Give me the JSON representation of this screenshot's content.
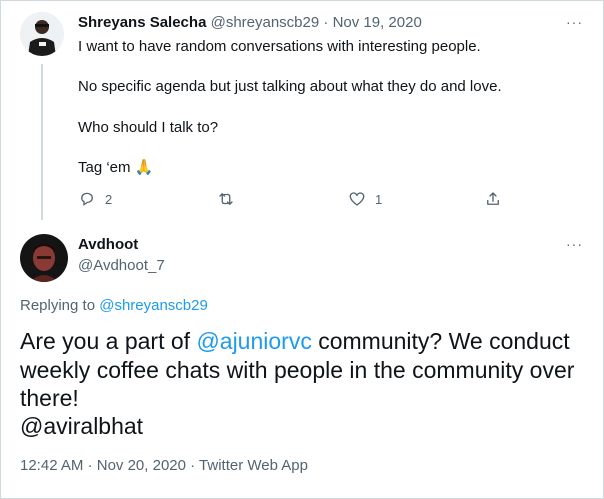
{
  "parent_tweet": {
    "author_name": "Shreyans Salecha",
    "handle": "@shreyanscb29",
    "separator": "·",
    "date": "Nov 19, 2020",
    "lines": [
      "I want to have random conversations with interesting people.",
      "No specific agenda but just talking about what they do and love.",
      "Who should I talk to?",
      "Tag ‘em"
    ],
    "emoji": "🙏",
    "actions": {
      "reply_count": "2",
      "retweet_count": "",
      "like_count": "1"
    }
  },
  "main_tweet": {
    "author_name": "Avdhoot",
    "handle": "@Avdhoot_7",
    "replying_prefix": "Replying to",
    "replying_handle": "@shreyanscb29",
    "text_part1": "Are you a part of ",
    "mention": "@ajuniorvc",
    "text_part2": " community? We conduct",
    "line2": "weekly coffee chats with people in the community over",
    "line3": "there!",
    "mention2": "@aviralbhat",
    "time": "12:42 AM",
    "separator": "·",
    "date": "Nov 20, 2020",
    "source": "Twitter Web App"
  },
  "more_icon": "···",
  "colors": {
    "link": "#1d9bf0",
    "muted": "#536471",
    "text": "#0f1419",
    "border": "#cfd9de"
  }
}
